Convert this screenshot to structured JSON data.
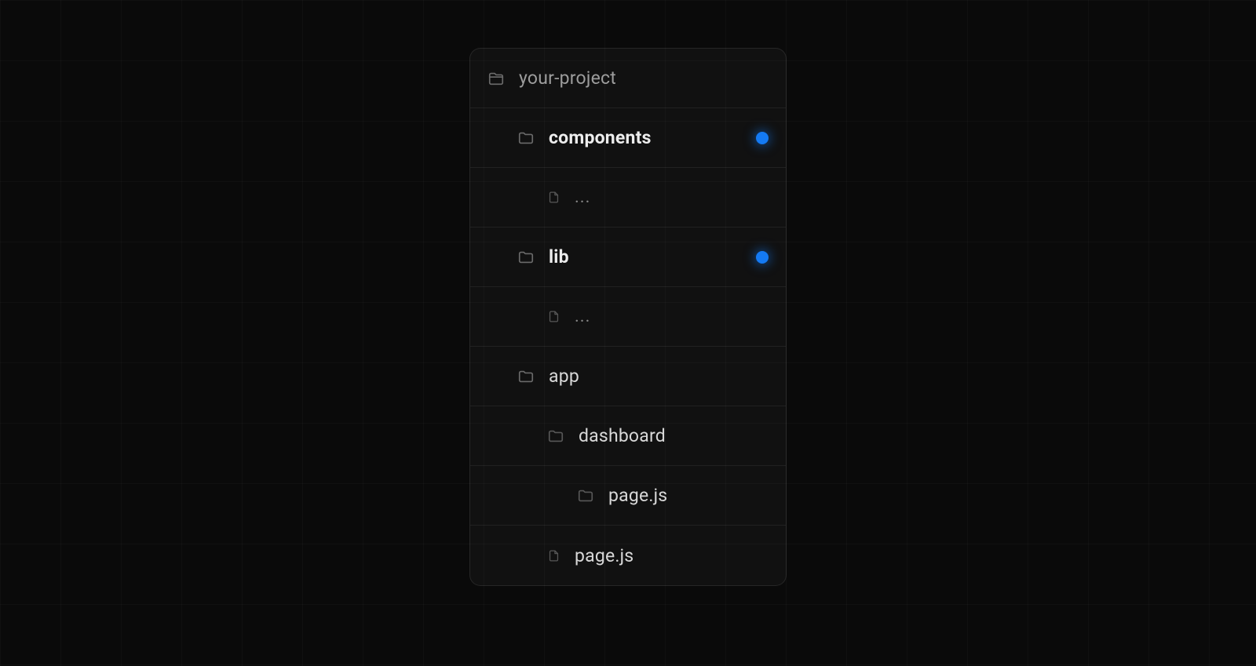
{
  "root": {
    "name": "your-project"
  },
  "tree": {
    "components": {
      "label": "components",
      "highlighted": true
    },
    "components_child": {
      "label": "..."
    },
    "lib": {
      "label": "lib",
      "highlighted": true
    },
    "lib_child": {
      "label": "..."
    },
    "app": {
      "label": "app"
    },
    "dashboard": {
      "label": "dashboard"
    },
    "dashboard_page": {
      "label": "page.js"
    },
    "app_page": {
      "label": "page.js"
    }
  },
  "colors": {
    "highlight_dot": "#147af3"
  }
}
